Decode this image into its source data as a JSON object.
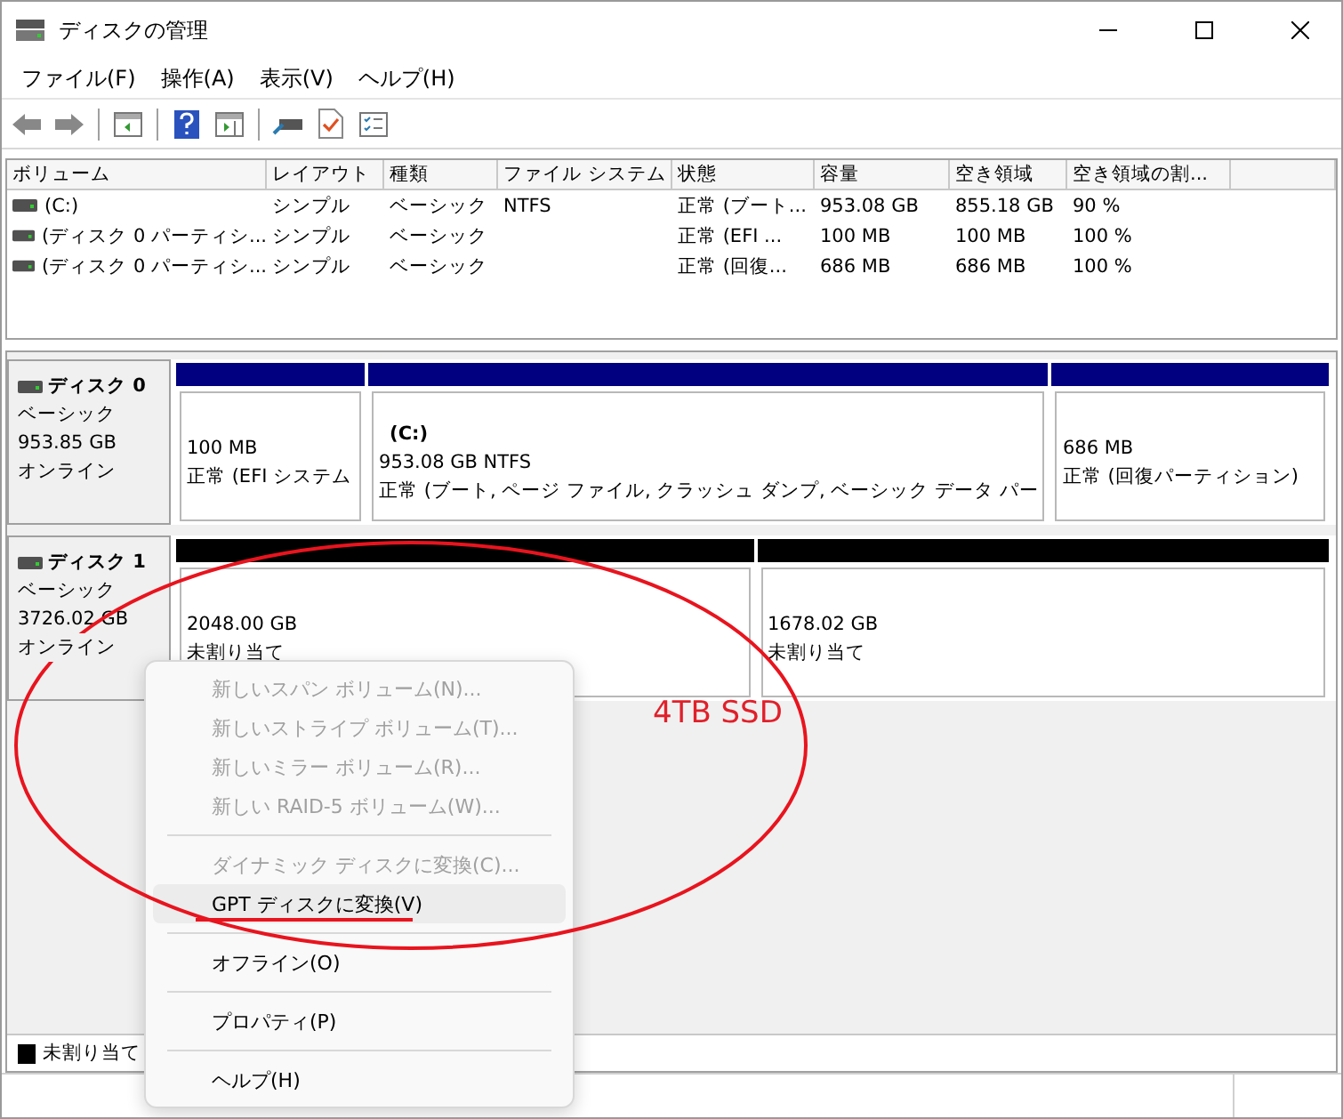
{
  "window": {
    "title": "ディスクの管理"
  },
  "menu_bar": [
    "ファイル(F)",
    "操作(A)",
    "表示(V)",
    "ヘルプ(H)"
  ],
  "volume_list": {
    "columns": [
      "ボリューム",
      "レイアウト",
      "種類",
      "ファイル システム",
      "状態",
      "容量",
      "空き領域",
      "空き領域の割..."
    ],
    "rows": [
      [
        "(C:)",
        "シンプル",
        "ベーシック",
        "NTFS",
        "正常 (ブート...",
        "953.08 GB",
        "855.18 GB",
        "90 %"
      ],
      [
        "(ディスク 0 パーティシ...",
        "シンプル",
        "ベーシック",
        "",
        "正常 (EFI ...",
        "100 MB",
        "100 MB",
        "100 %"
      ],
      [
        "(ディスク 0 パーティシ...",
        "シンプル",
        "ベーシック",
        "",
        "正常 (回復...",
        "686 MB",
        "686 MB",
        "100 %"
      ]
    ]
  },
  "disks": [
    {
      "name": "ディスク 0",
      "type": "ベーシック",
      "size": "953.85 GB",
      "status": "オンライン",
      "partitions": [
        {
          "size": "100 MB",
          "status": "正常 (EFI システム",
          "color": "#000080"
        },
        {
          "label": "(C:)",
          "size": "953.08 GB NTFS",
          "status": "正常 (ブート, ページ ファイル, クラッシュ ダンプ, ベーシック データ パー",
          "color": "#000080"
        },
        {
          "size": "686 MB",
          "status": "正常 (回復パーティション)",
          "color": "#000080"
        }
      ]
    },
    {
      "name": "ディスク 1",
      "type": "ベーシック",
      "size": "3726.02 GB",
      "status": "オンライン",
      "partitions": [
        {
          "size": "2048.00 GB",
          "status": "未割り当て",
          "color": "#000000"
        },
        {
          "size": "1678.02 GB",
          "status": "未割り当て",
          "color": "#000000"
        }
      ]
    }
  ],
  "legend": [
    {
      "label": "未割り当て",
      "color": "#000000"
    }
  ],
  "context_menu": [
    {
      "kind": "item",
      "label": "新しいスパン ボリューム(N)...",
      "disabled": true,
      "selected": false
    },
    {
      "kind": "item",
      "label": "新しいストライプ ボリューム(T)...",
      "disabled": true,
      "selected": false
    },
    {
      "kind": "item",
      "label": "新しいミラー ボリューム(R)...",
      "disabled": true,
      "selected": false
    },
    {
      "kind": "item",
      "label": "新しい RAID-5 ボリューム(W)...",
      "disabled": true,
      "selected": false
    },
    {
      "kind": "separator"
    },
    {
      "kind": "item",
      "label": "ダイナミック ディスクに変換(C)...",
      "disabled": true,
      "selected": false
    },
    {
      "kind": "item",
      "label": "GPT ディスクに変換(V)",
      "disabled": false,
      "selected": true
    },
    {
      "kind": "separator"
    },
    {
      "kind": "item",
      "label": "オフライン(O)",
      "disabled": false,
      "selected": false
    },
    {
      "kind": "separator"
    },
    {
      "kind": "item",
      "label": "プロパティ(P)",
      "disabled": false,
      "selected": false
    },
    {
      "kind": "separator"
    },
    {
      "kind": "item",
      "label": "ヘルプ(H)",
      "disabled": false,
      "selected": false
    }
  ],
  "annotation": {
    "label": "4TB SSD"
  }
}
